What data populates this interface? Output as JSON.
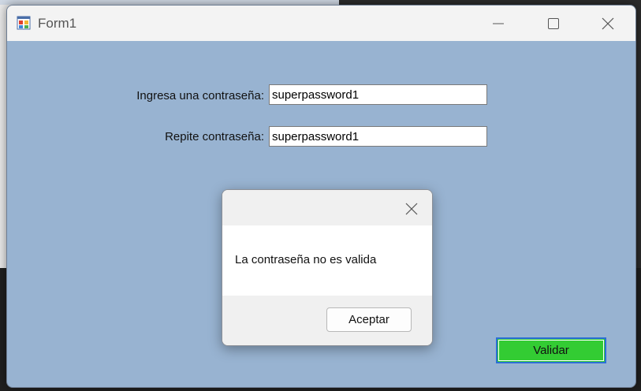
{
  "window": {
    "title": "Form1",
    "controls": {
      "minimize": "minimize-icon",
      "maximize": "maximize-icon",
      "close": "close-icon"
    }
  },
  "form": {
    "password_label": "Ingresa una contraseña:",
    "password_value": "superpassword1",
    "repeat_label": "Repite contraseña:",
    "repeat_value": "superpassword1",
    "validate_button": "Validar",
    "validate_color": "#33cc33",
    "background_color": "#98b3d1"
  },
  "dialog": {
    "message": "La contraseña no es valida",
    "accept_button": "Aceptar",
    "close_icon": "close-icon"
  }
}
